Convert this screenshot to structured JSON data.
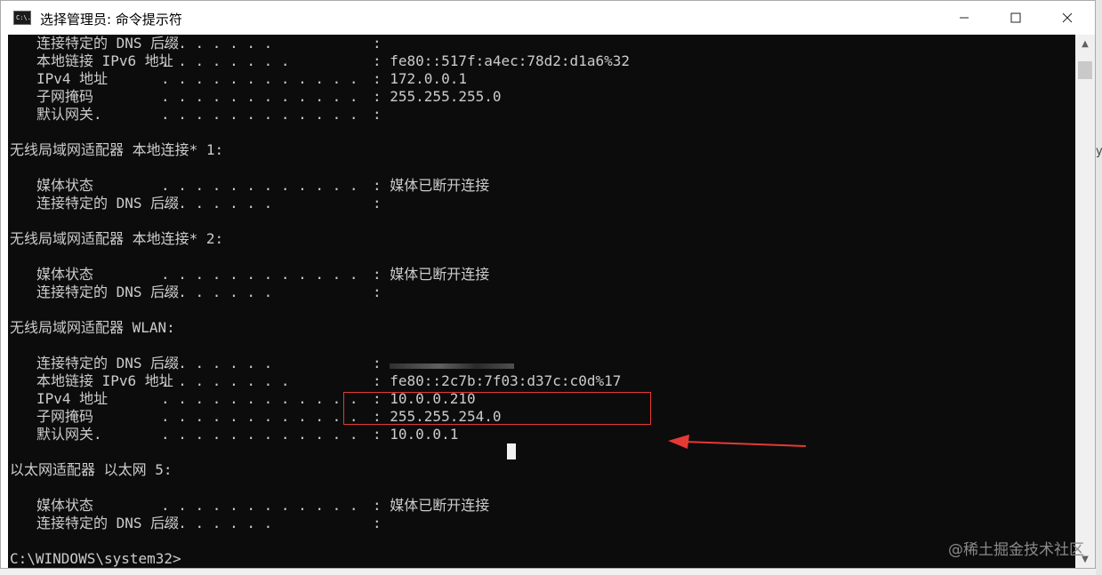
{
  "window": {
    "title": "选择管理员: 命令提示符",
    "icon_text": "C:\\.",
    "controls": [
      "minimize-icon",
      "maximize-icon",
      "close-icon"
    ]
  },
  "console": {
    "lines": [
      {
        "kind": "kv",
        "label": "连接特定的 DNS 后缀",
        "dots": ". . . . . . .",
        "value": ""
      },
      {
        "kind": "kv",
        "label": "本地链接 IPv6 地址",
        "dots": ". . . . . . . .",
        "value": "fe80::517f:a4ec:78d2:d1a6%32"
      },
      {
        "kind": "kv",
        "label": "IPv4 地址",
        "dots": ". . . . . . . . . . . .",
        "value": "172.0.0.1"
      },
      {
        "kind": "kv",
        "label": "子网掩码",
        "dots": ". . . . . . . . . . . .",
        "value": "255.255.255.0"
      },
      {
        "kind": "kv",
        "label": "默认网关.",
        "dots": ". . . . . . . . . . . .",
        "value": ""
      },
      {
        "kind": "blank"
      },
      {
        "kind": "header",
        "text": "无线局域网适配器 本地连接* 1:"
      },
      {
        "kind": "blank"
      },
      {
        "kind": "kv",
        "label": "媒体状态",
        "dots": ". . . . . . . . . . . .",
        "value": "媒体已断开连接"
      },
      {
        "kind": "kv",
        "label": "连接特定的 DNS 后缀",
        "dots": ". . . . . . .",
        "value": ""
      },
      {
        "kind": "blank"
      },
      {
        "kind": "header",
        "text": "无线局域网适配器 本地连接* 2:"
      },
      {
        "kind": "blank"
      },
      {
        "kind": "kv",
        "label": "媒体状态",
        "dots": ". . . . . . . . . . . .",
        "value": "媒体已断开连接"
      },
      {
        "kind": "kv",
        "label": "连接特定的 DNS 后缀",
        "dots": ". . . . . . .",
        "value": ""
      },
      {
        "kind": "blank"
      },
      {
        "kind": "header",
        "text": "无线局域网适配器 WLAN:"
      },
      {
        "kind": "blank"
      },
      {
        "kind": "kv_redacted",
        "label": "连接特定的 DNS 后缀",
        "dots": ". . . . . . ."
      },
      {
        "kind": "kv",
        "label": "本地链接 IPv6 地址",
        "dots": ". . . . . . . .",
        "value": "fe80::2c7b:7f03:d37c:c0d%17"
      },
      {
        "kind": "kv",
        "label": "IPv4 地址",
        "dots": ". . . . . . . . . . . .",
        "value": "10.0.0.210"
      },
      {
        "kind": "kv",
        "label": "子网掩码",
        "dots": ". . . . . . . . . . . .",
        "value": "255.255.254.0"
      },
      {
        "kind": "kv",
        "label": "默认网关.",
        "dots": ". . . . . . . . . . . .",
        "value": "10.0.0.1"
      },
      {
        "kind": "blank"
      },
      {
        "kind": "header",
        "text": "以太网适配器 以太网 5:"
      },
      {
        "kind": "blank"
      },
      {
        "kind": "kv",
        "label": "媒体状态",
        "dots": ". . . . . . . . . . . .",
        "value": "媒体已断开连接"
      },
      {
        "kind": "kv",
        "label": "连接特定的 DNS 后缀",
        "dots": ". . . . . . .",
        "value": ""
      },
      {
        "kind": "blank"
      },
      {
        "kind": "prompt",
        "text": "C:\\WINDOWS\\system32>"
      }
    ]
  },
  "annotations": {
    "highlight_color": "#e53935",
    "arrow_color": "#e53935"
  },
  "watermark": "@稀土掘金技术社区",
  "edge_text": "y"
}
